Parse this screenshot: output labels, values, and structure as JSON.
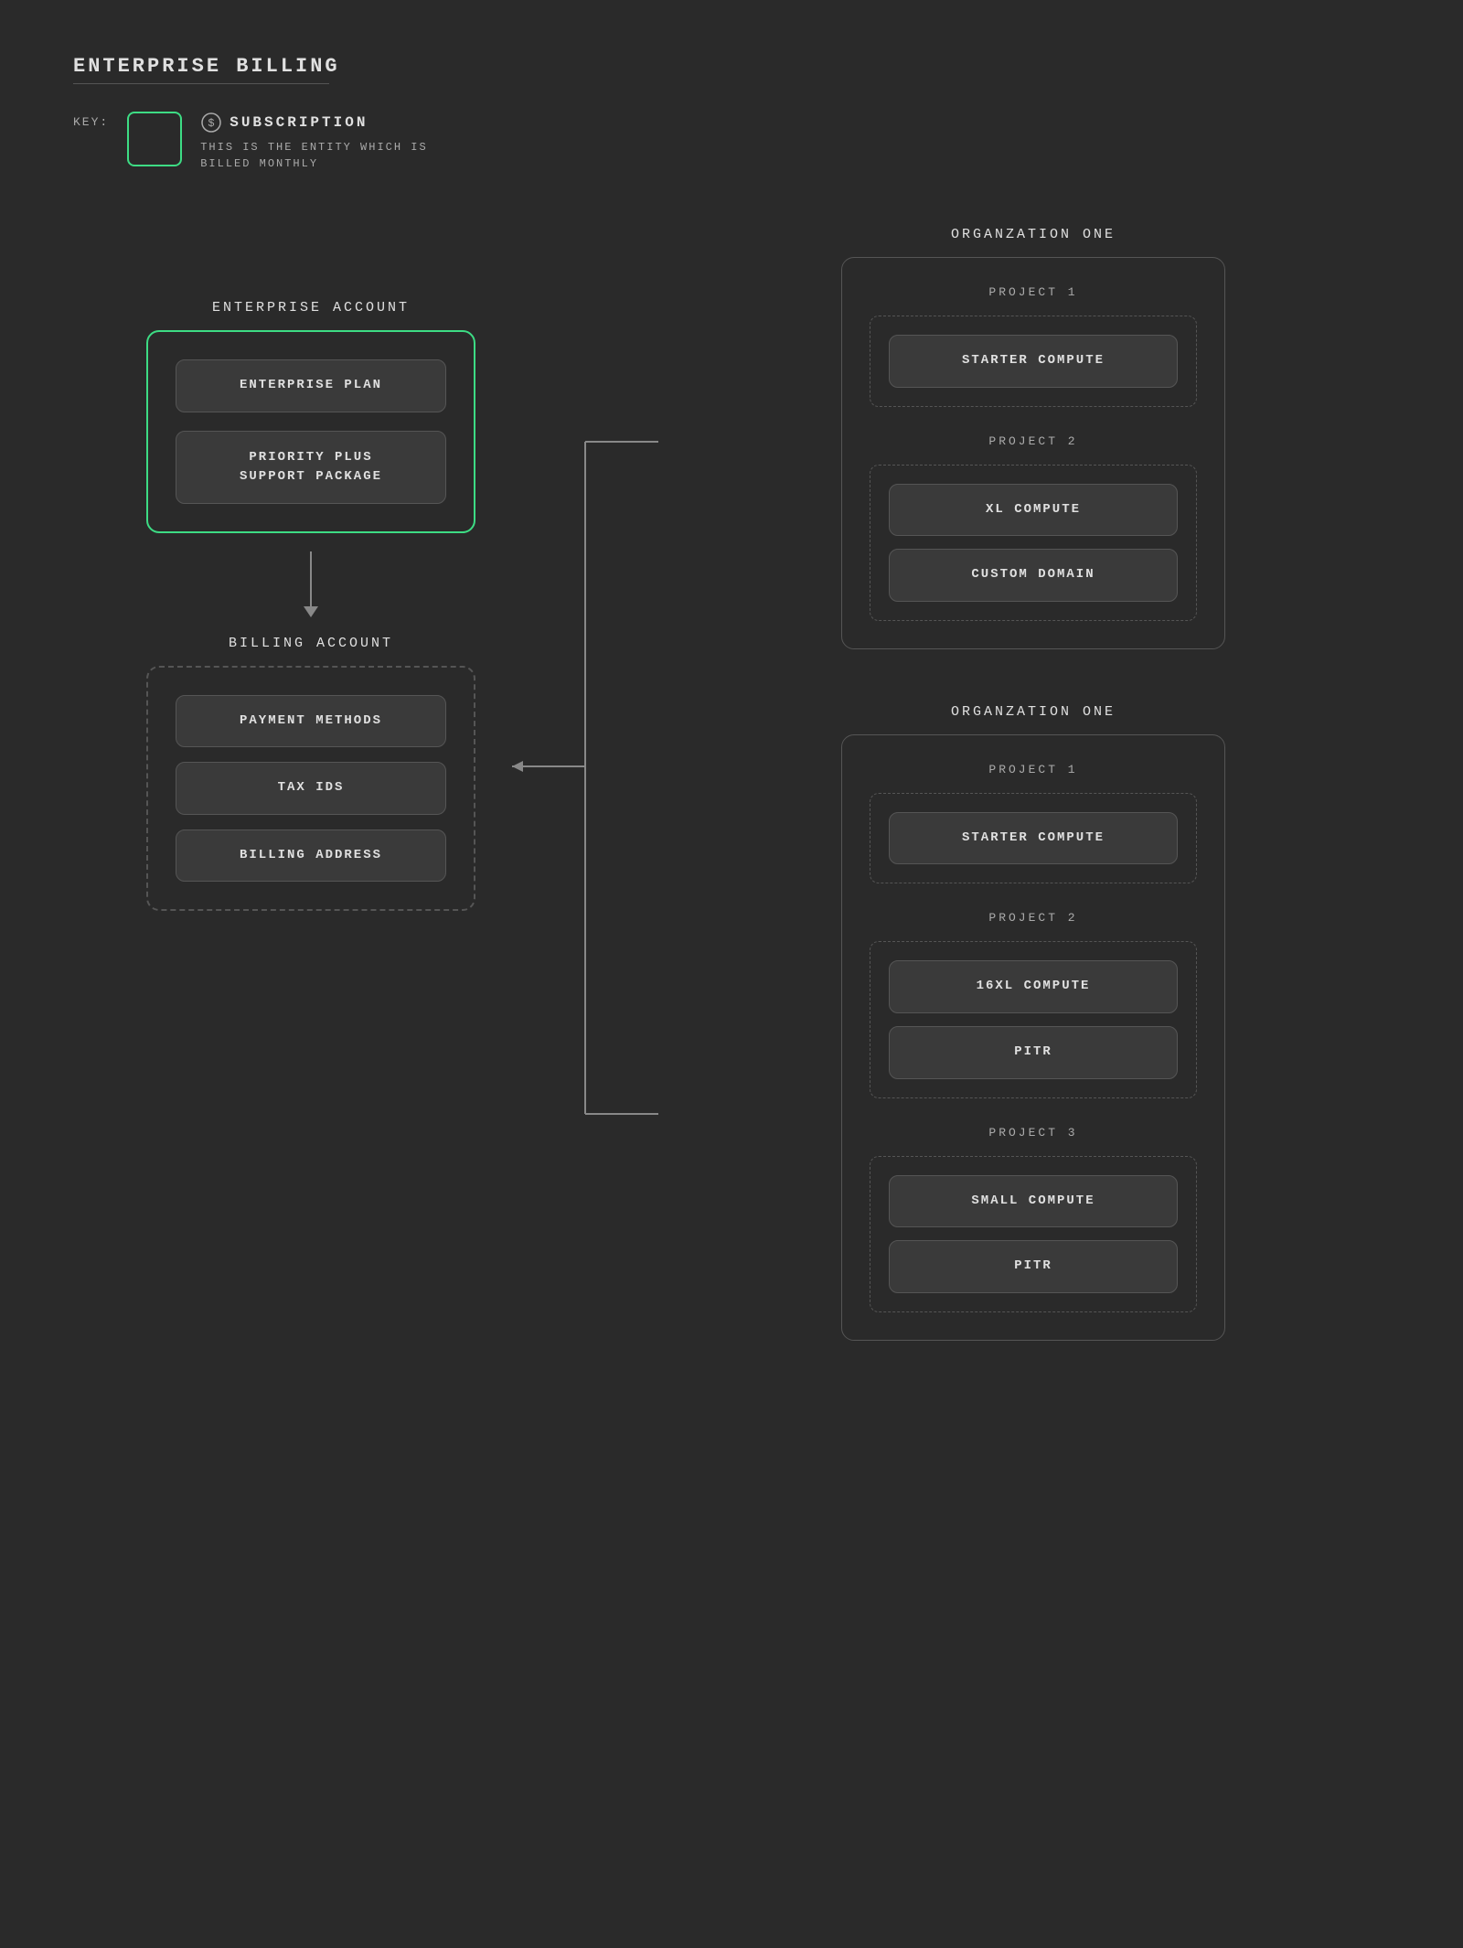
{
  "page": {
    "title": "ENTERPRISE BILLING",
    "key_label": "KEY:"
  },
  "key": {
    "icon": "💲",
    "title": "SUBSCRIPTION",
    "subtitle": "THIS IS THE ENTITY WHICH IS\nBILLED MONTHLY"
  },
  "left": {
    "enterprise_account_label": "ENTERPRISE ACCOUNT",
    "enterprise_plan_label": "ENTERPRISE PLAN",
    "priority_support_label": "PRIORITY PLUS\nSUPPORT PACKAGE",
    "billing_account_label": "BILLING ACCOUNT",
    "payment_methods_label": "PAYMENT METHODS",
    "tax_ids_label": "TAX IDS",
    "billing_address_label": "BILLING ADDRESS"
  },
  "right": {
    "org1": {
      "label": "ORGANZATION ONE",
      "project1": {
        "label": "PROJECT 1",
        "items": [
          "STARTER COMPUTE"
        ]
      },
      "project2": {
        "label": "PROJECT 2",
        "items": [
          "XL COMPUTE",
          "CUSTOM DOMAIN"
        ]
      }
    },
    "org2": {
      "label": "ORGANZATION ONE",
      "project1": {
        "label": "PROJECT 1",
        "items": [
          "STARTER COMPUTE"
        ]
      },
      "project2": {
        "label": "PROJECT 2",
        "items": [
          "16XL COMPUTE",
          "PITR"
        ]
      },
      "project3": {
        "label": "PROJECT 3",
        "items": [
          "SMALL COMPUTE",
          "PITR"
        ]
      }
    }
  }
}
